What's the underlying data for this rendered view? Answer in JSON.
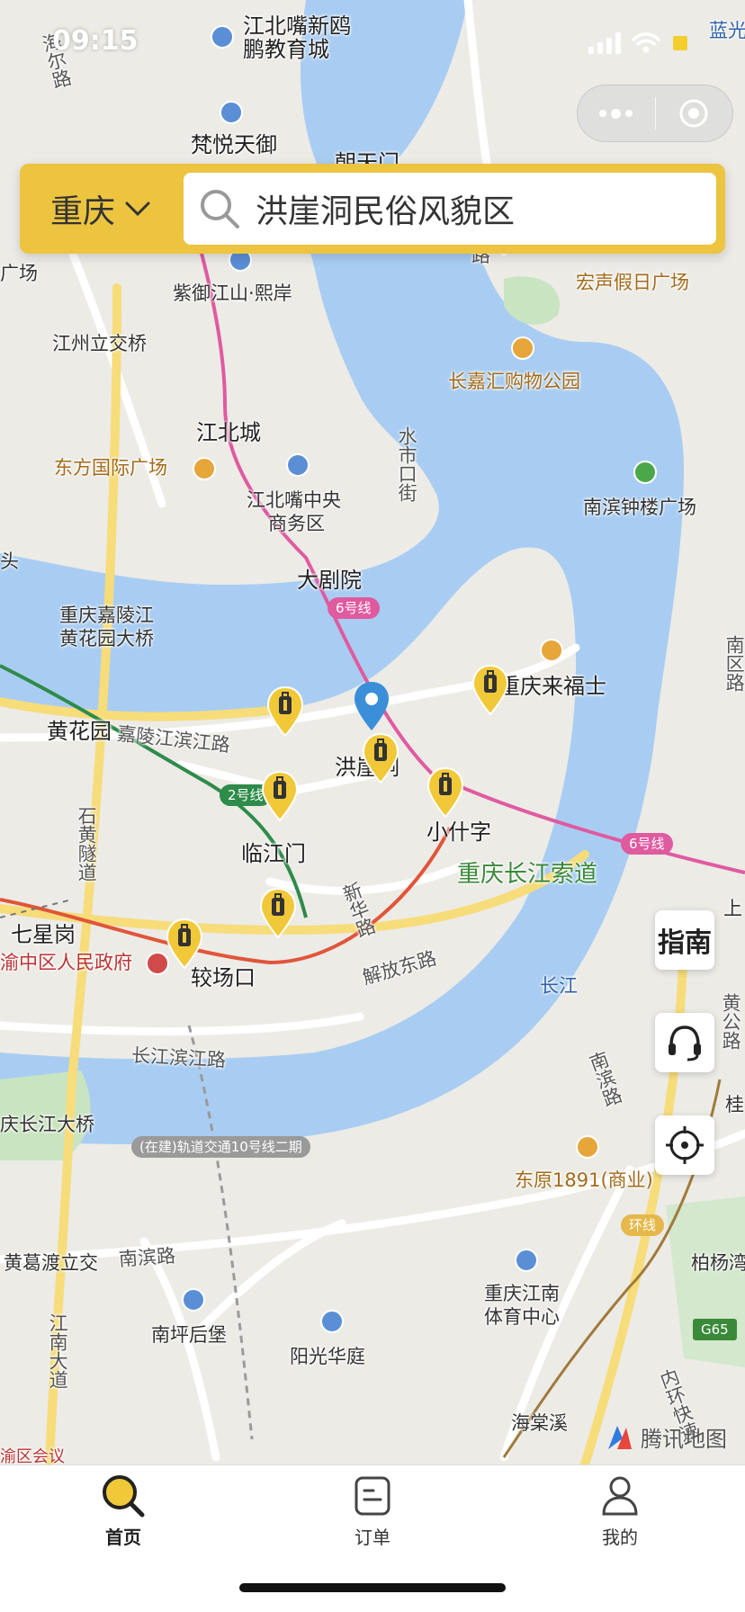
{
  "status": {
    "time": "09:15"
  },
  "header": {
    "city": "重庆",
    "search_value": "洪崖洞民俗风貌区"
  },
  "side_buttons": {
    "guide": "指南"
  },
  "map": {
    "attribution": "腾讯地图",
    "labels": {
      "l01": "江北嘴新鸥",
      "l02": "鹏教育城",
      "l03": "梵悦天御",
      "l04": "朝天门",
      "l05": "蓝光",
      "l06": "广场",
      "l07": "紫御江山·熙岸",
      "l08": "江州立交桥",
      "l09": "宏声假日广场",
      "l10": "长嘉汇购物公园",
      "l11": "江北城",
      "l12": "东方国际广场",
      "l13": "水市口街",
      "l14": "江北嘴中央",
      "l15": "商务区",
      "l16": "南滨钟楼广场",
      "l17": "大剧院",
      "l18": "重庆嘉陵江",
      "l19": "黄花园大桥",
      "l20": "黄花园",
      "l21": "嘉陵江滨江路",
      "l22": "重庆来福士",
      "l23": "洪崖洞",
      "l24": "小什字",
      "l25": "临江门",
      "l26": "重庆长江索道",
      "l27": "石黄隧道",
      "l28": "七星岗",
      "l29": "渝中区人民政府",
      "l30": "较场口",
      "l31": "新华路",
      "l32": "解放东路",
      "l33": "长江",
      "l34": "南滨路",
      "l35": "长江滨江路",
      "l36": "庆长江大桥",
      "l37": "东原1891(商业)",
      "l38": "黄葛渡立交",
      "l39": "南滨路",
      "l40": "柏杨湾",
      "l41": "重庆江南",
      "l42": "体育中心",
      "l43": "南坪后堡",
      "l44": "阳光华庭",
      "l45": "江南大道",
      "l46": "海棠溪",
      "l47": "内环快速",
      "l48": "黄公路",
      "l49": "上",
      "l50": "桂",
      "l51": "头",
      "l52": "海尔路",
      "l53": "路",
      "l54": "南区路",
      "l55": "渝区会议"
    },
    "badges": {
      "line6a": "6号线",
      "line6b": "6号线",
      "line2": "2号线",
      "line10": "(在建)轨道交通10号线二期",
      "ring": "环线",
      "g65": "G65"
    }
  },
  "tabs": [
    {
      "label": "首页",
      "icon": "home-search-icon",
      "active": true
    },
    {
      "label": "订单",
      "icon": "order-icon",
      "active": false
    },
    {
      "label": "我的",
      "icon": "profile-icon",
      "active": false
    }
  ],
  "colors": {
    "accent": "#ecc43f",
    "water": "#a9cdf2",
    "land": "#ecebe6",
    "metro6": "#e05aa0",
    "metro2": "#2e8b4a",
    "metro1": "#e0553a"
  }
}
